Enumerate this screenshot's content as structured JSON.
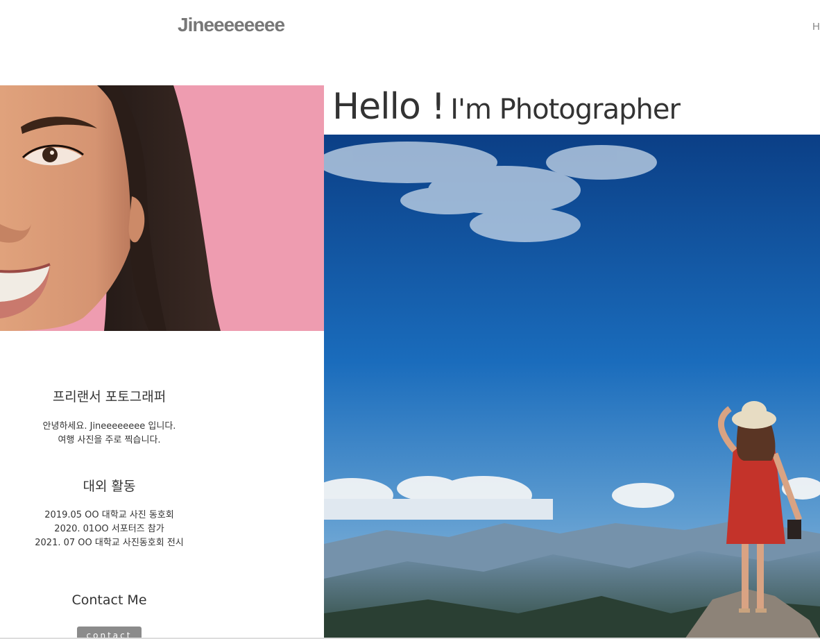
{
  "header": {
    "logo": "Jineeeeeeee",
    "nav_home": "H"
  },
  "hero": {
    "hello": "Hello !",
    "subtitle": "I'm Photographer"
  },
  "profile": {
    "title": "프리랜서 포토그래퍼",
    "intro_lines": [
      "안녕하세요. Jineeeeeeee 입니다.",
      "여행 사진을 주로 찍습니다."
    ],
    "activities_title": "대외 활동",
    "activities": [
      "2019.05 OO 대학교 사진 동호회",
      "2020. 01OO 서포터즈 참가",
      "2021. 07 OO 대학교 사진동호회 전시"
    ],
    "contact_title": "Contact Me",
    "contact_button": "contact"
  },
  "colors": {
    "portrait_bg": "#ee9cb0",
    "sky_top": "#0b3f86",
    "sky_bottom": "#5c9bd0",
    "button": "#8b8b8b"
  }
}
